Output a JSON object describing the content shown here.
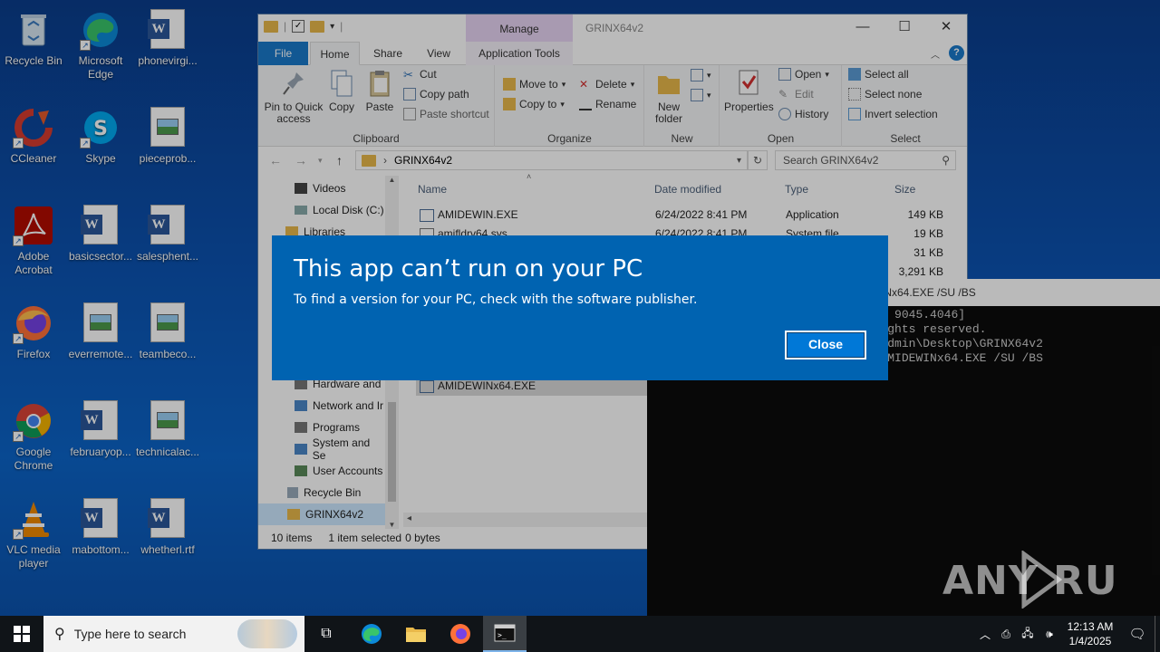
{
  "desktop": {
    "icons": [
      {
        "label": "Recycle Bin",
        "icon": "recycle-bin-icon"
      },
      {
        "label": "Microsoft Edge",
        "icon": "edge-icon"
      },
      {
        "label": "phonevirgi...",
        "icon": "word-doc-icon"
      },
      {
        "label": "CCleaner",
        "icon": "ccleaner-icon"
      },
      {
        "label": "Skype",
        "icon": "skype-icon"
      },
      {
        "label": "pieceprob...",
        "icon": "image-file-icon"
      },
      {
        "label": "Adobe Acrobat",
        "icon": "acrobat-icon"
      },
      {
        "label": "basicsector...",
        "icon": "word-doc-icon"
      },
      {
        "label": "salesphent...",
        "icon": "word-doc-icon"
      },
      {
        "label": "Firefox",
        "icon": "firefox-icon"
      },
      {
        "label": "everremote...",
        "icon": "image-file-icon"
      },
      {
        "label": "teambeco...",
        "icon": "image-file-icon"
      },
      {
        "label": "Google Chrome",
        "icon": "chrome-icon"
      },
      {
        "label": "februaryop...",
        "icon": "word-doc-icon"
      },
      {
        "label": "technicalac...",
        "icon": "image-file-icon"
      },
      {
        "label": "VLC media player",
        "icon": "vlc-icon"
      },
      {
        "label": "mabottom...",
        "icon": "word-doc-icon"
      },
      {
        "label": "whetherl.rtf",
        "icon": "word-doc-icon"
      }
    ]
  },
  "explorer": {
    "title": "GRINX64v2",
    "manage_tab": "Manage",
    "tabs": {
      "file": "File",
      "home": "Home",
      "share": "Share",
      "view": "View",
      "app_tools": "Application Tools"
    },
    "ribbon": {
      "pin": "Pin to Quick access",
      "copy": "Copy",
      "paste": "Paste",
      "cut": "Cut",
      "copy_path": "Copy path",
      "paste_shortcut": "Paste shortcut",
      "clipboard": "Clipboard",
      "move_to": "Move to",
      "copy_to": "Copy to",
      "delete": "Delete",
      "rename": "Rename",
      "organize": "Organize",
      "new_folder": "New folder",
      "new": "New",
      "properties": "Properties",
      "open": "Open",
      "edit": "Edit",
      "history": "History",
      "open_group": "Open",
      "select_all": "Select all",
      "select_none": "Select none",
      "invert_selection": "Invert selection",
      "select": "Select"
    },
    "address": "GRINX64v2",
    "search_placeholder": "Search GRINX64v2",
    "nav": [
      {
        "label": "Videos"
      },
      {
        "label": "Local Disk (C:)"
      },
      {
        "label": "Libraries"
      },
      {
        "label": "Hardware and"
      },
      {
        "label": "Network and Ir"
      },
      {
        "label": "Programs"
      },
      {
        "label": "System and Se"
      },
      {
        "label": "User Accounts"
      },
      {
        "label": "Recycle Bin"
      },
      {
        "label": "GRINX64v2"
      }
    ],
    "columns": {
      "name": "Name",
      "date": "Date modified",
      "type": "Type",
      "size": "Size"
    },
    "files": [
      {
        "name": "AMIDEWIN.EXE",
        "date": "6/24/2022 8:41 PM",
        "type": "Application",
        "size": "149 KB"
      },
      {
        "name": "amifldrv64.sys",
        "date": "6/24/2022 8:41 PM",
        "type": "System file",
        "size": "19 KB"
      },
      {
        "name": "",
        "date": "",
        "type": "",
        "size": "31 KB"
      },
      {
        "name": "",
        "date": "",
        "type": "",
        "size": "3,291 KB"
      },
      {
        "name": "AMIDEWINx64.EXE",
        "date": "",
        "type": "",
        "size": ""
      }
    ],
    "status": {
      "items": "10 items",
      "selected": "1 item selected",
      "bytes": "0 bytes"
    }
  },
  "terminal": {
    "title": "INx64.EXE /SU /BS",
    "lines": [
      "                                   9045.4046]",
      "                                  ghts reserved.",
      "",
      "                                  dmin\\Desktop\\GRINX64v2",
      "",
      "C:\\Users\\admin\\Desktop\\GRINX64v2>AMIDEWINx64.EXE /SU /BS"
    ]
  },
  "dialog": {
    "title": "This app can’t run on your PC",
    "message": "To find a version for your PC, check with the software publisher.",
    "close": "Close"
  },
  "watermark": "ANY RUN",
  "taskbar": {
    "search_placeholder": "Type here to search",
    "time": "12:13 AM",
    "date": "1/4/2025"
  },
  "colors": {
    "dialog_bg": "#0063b1",
    "accent": "#0078d7",
    "taskbar": "#101418"
  }
}
